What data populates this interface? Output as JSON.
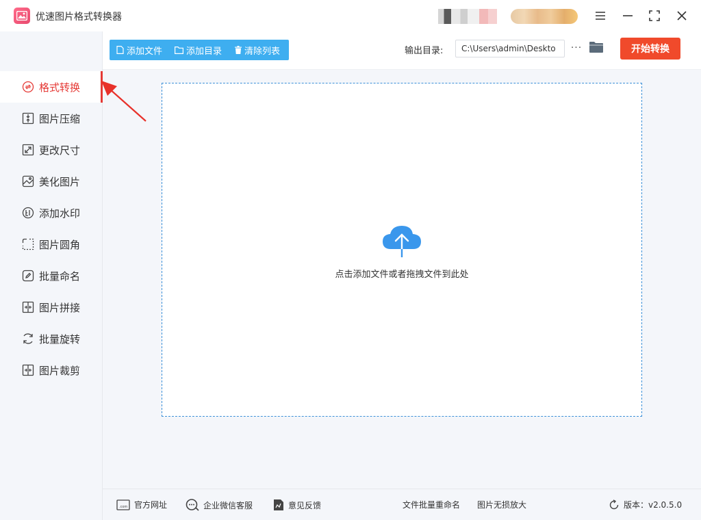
{
  "app": {
    "title": "优速图片格式转换器"
  },
  "window": {
    "menu_icon": "menu-icon",
    "min_icon": "minimize-icon",
    "max_icon": "maximize-icon",
    "close_icon": "close-icon"
  },
  "sidebar": {
    "items": [
      {
        "label": "格式转换",
        "icon": "convert-icon",
        "active": true
      },
      {
        "label": "图片压缩",
        "icon": "compress-icon"
      },
      {
        "label": "更改尺寸",
        "icon": "resize-icon"
      },
      {
        "label": "美化图片",
        "icon": "beautify-icon"
      },
      {
        "label": "添加水印",
        "icon": "watermark-icon"
      },
      {
        "label": "图片圆角",
        "icon": "round-corner-icon"
      },
      {
        "label": "批量命名",
        "icon": "rename-icon"
      },
      {
        "label": "图片拼接",
        "icon": "stitch-icon"
      },
      {
        "label": "批量旋转",
        "icon": "rotate-icon"
      },
      {
        "label": "图片裁剪",
        "icon": "crop-icon"
      }
    ]
  },
  "toolbar": {
    "add_file": "添加文件",
    "add_dir": "添加目录",
    "clear_list": "清除列表",
    "output_label": "输出目录:",
    "output_path": "C:\\Users\\admin\\Deskto",
    "more": "···",
    "start": "开始转换"
  },
  "main": {
    "drop_text": "点击添加文件或者拖拽文件到此处"
  },
  "footer": {
    "site": "官方网址",
    "wechat": "企业微信客服",
    "feedback": "意见反馈",
    "batch_rename": "文件批量重命名",
    "lossless": "图片无损放大",
    "version": "版本：v2.0.5.0"
  },
  "colors": {
    "accent": "#3eaef0",
    "start": "#f04a2b",
    "active": "#e53935"
  }
}
